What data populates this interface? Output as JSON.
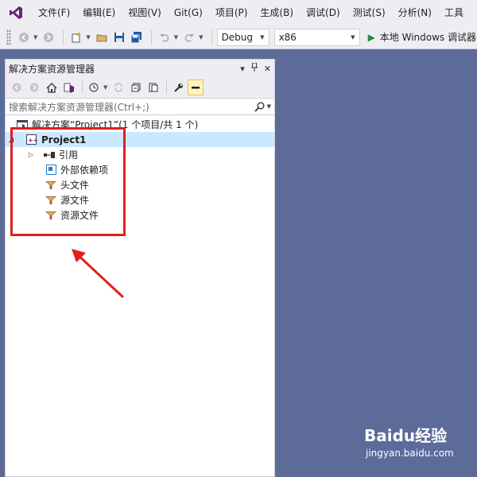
{
  "menubar": {
    "items": [
      "文件(F)",
      "编辑(E)",
      "视图(V)",
      "Git(G)",
      "项目(P)",
      "生成(B)",
      "调试(D)",
      "测试(S)",
      "分析(N)",
      "工具"
    ]
  },
  "toolbar": {
    "configuration": "Debug",
    "platform": "x86",
    "run_label": "本地 Windows 调试器"
  },
  "solution_explorer": {
    "title": "解决方案资源管理器",
    "pin_glyph": "▾",
    "close_glyph": "✕",
    "search_placeholder": "搜索解决方案资源管理器(Ctrl+;)",
    "solution_label": "解决方案“Project1”(1 个项目/共 1 个)",
    "project_label": "Project1",
    "nodes": [
      "引用",
      "外部依赖项",
      "头文件",
      "源文件",
      "资源文件"
    ]
  },
  "watermark": {
    "logo_text": "Baidu经验",
    "url": "jingyan.baidu.com"
  },
  "colors": {
    "background": "#5d6b99",
    "highlight": "#e02020",
    "selection": "#cce8ff",
    "vs_purple": "#68217a"
  }
}
